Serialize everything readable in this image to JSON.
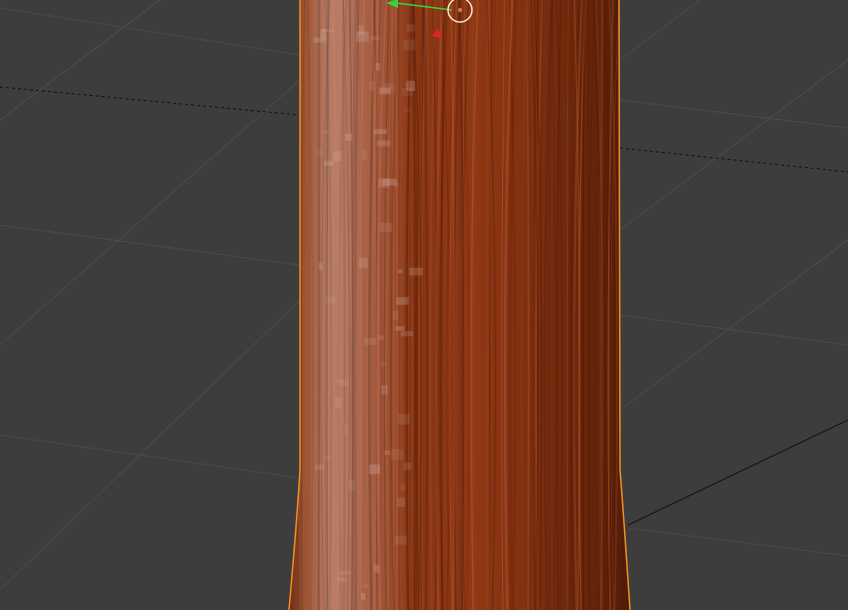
{
  "viewport": {
    "background_color": "#3d3d3d",
    "grid_color": "#4a4a4a",
    "axis_line_color": "#111111",
    "selection_outline_color": "#f29120",
    "object": {
      "name": "",
      "material": "wood-bark-texture",
      "base_color": "#8a3512",
      "highlight_color": "#c9a79b"
    },
    "gizmo": {
      "icon": "transform-gizmo-icon",
      "y_axis_color": "#3bd23b",
      "x_axis_color": "#e02424",
      "pivot_color": "#f4e6d2"
    }
  }
}
